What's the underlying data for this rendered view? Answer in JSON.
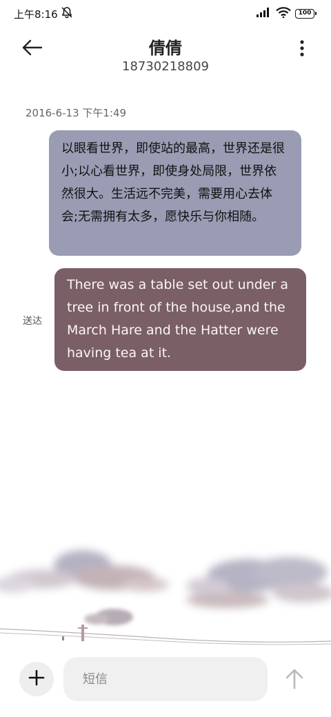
{
  "status_bar": {
    "time": "上午8:16",
    "battery": "100",
    "icons": [
      "bell-off-icon",
      "signal-icon",
      "wifi-icon",
      "battery-icon"
    ]
  },
  "header": {
    "contact_name": "倩倩",
    "phone_number": "18730218809",
    "icons": [
      "back-arrow-icon",
      "more-vertical-icon"
    ]
  },
  "conversation": {
    "timestamp": "2016-6-13 下午1:49",
    "messages": [
      {
        "direction": "received",
        "text": "以眼看世界，即使站的最高，世界还是很小;以心看世界，即使身处局限，世界依然很大。生活远不完美，需要用心去体会;无需拥有太多，愿快乐与你相随。",
        "bubble_color": "#9a9cb4"
      },
      {
        "direction": "sent",
        "text": "There was a table set out under a tree in front of the house,and the March Hare and the Hatter were having tea at it.",
        "status": "送达",
        "bubble_color": "#7a5f66"
      }
    ]
  },
  "composer": {
    "placeholder": "短信",
    "value": "",
    "icons": [
      "plus-icon",
      "send-arrow-icon"
    ]
  },
  "colors": {
    "background": "#ffffff",
    "received_bubble": "#9a9cb4",
    "sent_bubble": "#7a5f66",
    "input_bg": "#f0f0f0"
  }
}
